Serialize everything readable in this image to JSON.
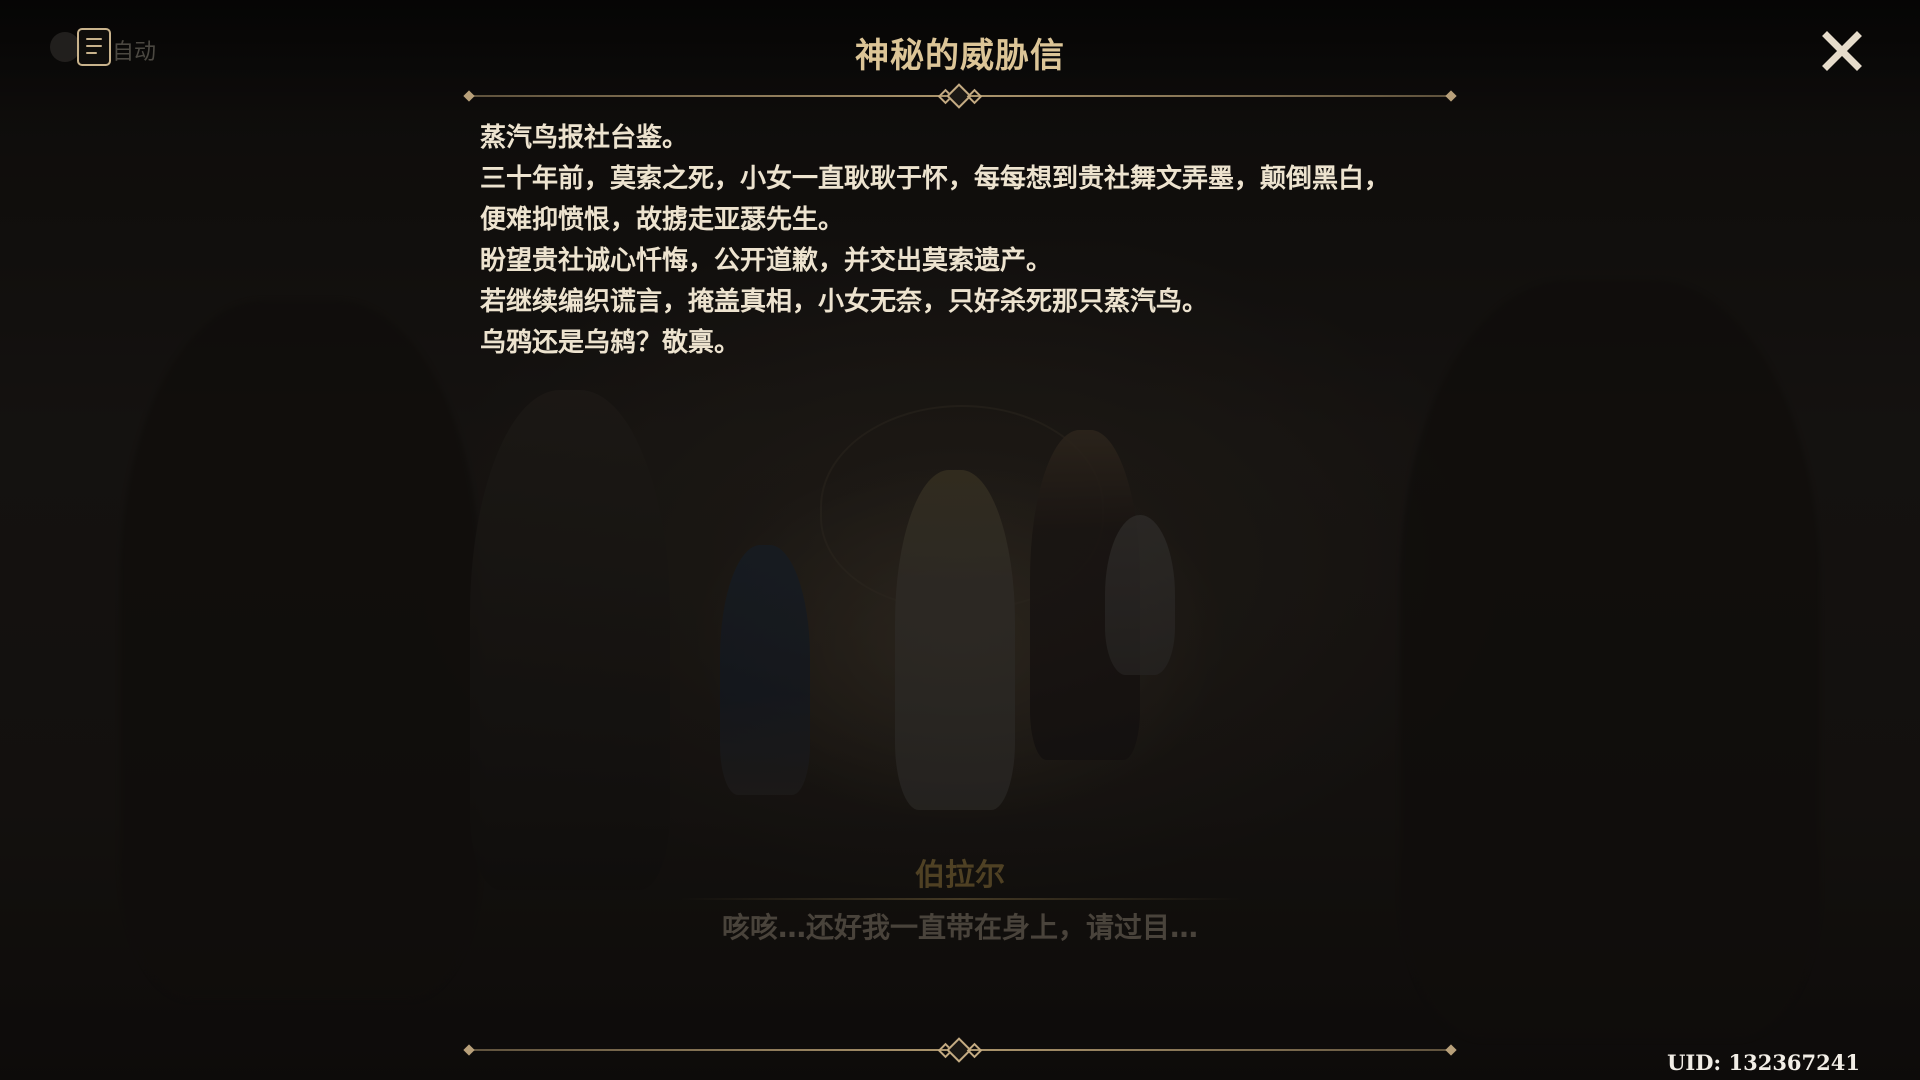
{
  "auto_play": {
    "label": "自动",
    "icon": "document-list-icon"
  },
  "letter": {
    "title": "神秘的威胁信",
    "lines": [
      "蒸汽鸟报社台鉴。",
      "三十年前，莫索之死，小女一直耿耿于怀，每每想到贵社舞文弄墨，颠倒黑白，",
      "便难抑愤恨，故掳走亚瑟先生。",
      "盼望贵社诚心忏悔，公开道歉，并交出莫索遗产。",
      "若继续编织谎言，掩盖真相，小女无奈，只好杀死那只蒸汽鸟。",
      "乌鸦还是乌鸫？敬禀。"
    ]
  },
  "close_button": {
    "icon": "close-icon"
  },
  "dialogue": {
    "speaker": "伯拉尔",
    "text": "咳咳…还好我一直带在身上，请过目…"
  },
  "uid": "UID: 132367241",
  "colors": {
    "title_gold": "#dcc597",
    "letter_text": "#ede3cf",
    "divider_gold": "#c4ab82",
    "speaker_gold": "#826937"
  }
}
